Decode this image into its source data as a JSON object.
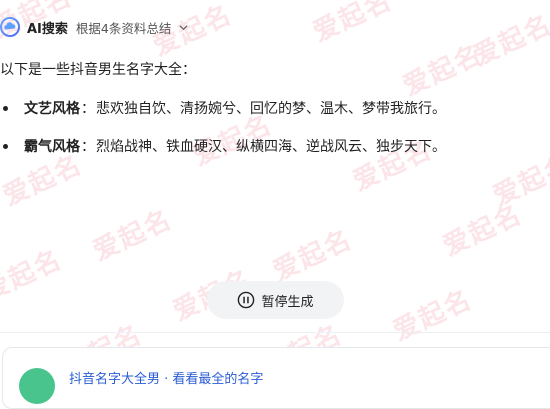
{
  "header": {
    "title": "AI搜索",
    "subtitle": "根据4条资料总结"
  },
  "answer": {
    "intro": "以下是一些抖音男生名字大全：",
    "items": [
      {
        "name": "文艺风格",
        "colon": "：",
        "text": "悲欢独自饮、清扬婉兮、回忆的梦、温木、梦带我旅行。"
      },
      {
        "name": "霸气风格",
        "colon": "：",
        "text": "烈焰战神、铁血硬汉、纵横四海、逆战风云、独步天下。"
      }
    ]
  },
  "pause_button": {
    "label": "暂停生成"
  },
  "result_card": {
    "title": "抖音名字大全男 · 看看最全的名字"
  },
  "watermark": {
    "text": "爱起名"
  },
  "colors": {
    "accent": "#2a5cd6",
    "watermark": "#f0657d",
    "avatar": "#49c48d"
  }
}
